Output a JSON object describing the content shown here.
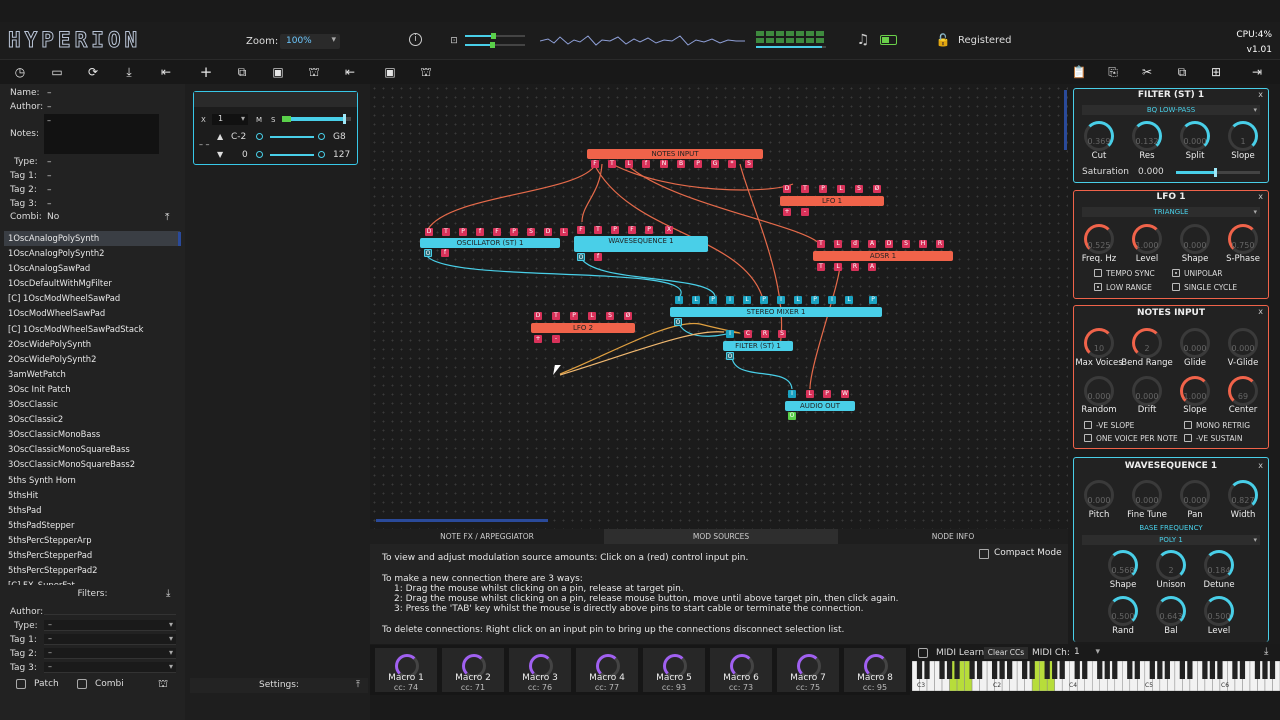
{
  "app": {
    "logo": "HYPERION",
    "zoom_label": "Zoom:",
    "zoom_value": "100%",
    "registered": "Registered",
    "cpu": "CPU:4%",
    "version": "v1.01"
  },
  "colors": {
    "accent_cyan": "#49cfe8",
    "node_red": "#f0634a",
    "pin_red": "#d9325a",
    "macro_purple": "#a060f0"
  },
  "toolbar": {
    "left_icons": [
      "history-icon",
      "folder-icon",
      "refresh-icon",
      "download-icon",
      "first-icon",
      "add-icon",
      "copy-icon",
      "save-icon",
      "patch-bay-icon",
      "first-icon"
    ],
    "mid_icons": [
      "save-icon",
      "patch-bay-icon"
    ],
    "right_icons": [
      "clipboard-icon",
      "paste-icon",
      "cut-icon",
      "duplicate-icon",
      "grid-icon",
      "exit-icon"
    ]
  },
  "meta": {
    "name_label": "Name:",
    "name": "–",
    "author_label": "Author:",
    "author": "–",
    "notes_label": "Notes:",
    "notes": "–",
    "type_label": "Type:",
    "type": "–",
    "tag1_label": "Tag 1:",
    "tag1": "–",
    "tag2_label": "Tag 2:",
    "tag2": "–",
    "tag3_label": "Tag 3:",
    "tag3": "–",
    "combi_label": "Combi:",
    "combi": "No"
  },
  "patches": [
    "1OscAnalogPolySynth",
    "1OscAnalogPolySynth2",
    "1OscAnalogSawPad",
    "1OscDefaultWithMgFilter",
    "[C] 1OscModWheelSawPad",
    "1OscModWheelSawPad",
    "[C] 1OscModWheelSawPadStack",
    "2OscWidePolySynth",
    "2OscWidePolySynth2",
    "3amWetPatch",
    "3Osc Init Patch",
    "3OscClassic",
    "3OscClassic2",
    "3OscClassicMonoBass",
    "3OscClassicMonoSquareBass",
    "3OscClassicMonoSquareBass2",
    "5ths Synth Horn",
    "5thsHit",
    "5thsPad",
    "5thsPadStepper",
    "5thsPercStepperArp",
    "5thsPercStepperPad",
    "5thsPercStepperPad2",
    "[C] FX_SuperFat"
  ],
  "filters": {
    "title": "Filters:",
    "author_label": "Author:",
    "type_label": "Type:",
    "type": "–",
    "tag1_label": "Tag 1:",
    "tag1": "–",
    "tag2_label": "Tag 2:",
    "tag2": "–",
    "tag3_label": "Tag 3:",
    "tag3": "–",
    "patch_label": "Patch",
    "combi_label": "Combi"
  },
  "kbzone": {
    "x": "X",
    "channel": "1",
    "m": "M",
    "s": "S",
    "low_note": "C-2",
    "high_note": "G8",
    "low_vel": "0",
    "high_vel": "127",
    "dash": "– –"
  },
  "settings_label": "Settings:",
  "nodes": {
    "notes_input": "NOTES INPUT",
    "lfo1": "LFO 1",
    "oscillator": "OSCILLATOR (ST) 1",
    "waveseq": "WAVESEQUENCE 1",
    "adsr": "ADSR 1",
    "stereo_mixer": "STEREO MIXER 1",
    "lfo2": "LFO 2",
    "filter": "FILTER (ST) 1",
    "audio_out": "AUDIO OUT"
  },
  "tabs": {
    "note_fx": "NOTE FX / ARPEGGIATOR",
    "mod_sources": "MOD SOURCES",
    "node_info": "NODE INFO",
    "compact": "Compact Mode"
  },
  "info": {
    "l1": "To view and adjust modulation source amounts: Click on a (red) control input pin.",
    "l2": "To make a new connection there are 3 ways:",
    "l3": "1: Drag the mouse whilst clicking on a pin, release at target pin.",
    "l4": "2: Drag the mouse whilst clicking on a pin, release mouse button, move until above target pin, then click again.",
    "l5": "3: Press the 'TAB' key whilst the mouse is directly above pins to start cable or terminate the connection.",
    "l6": "To delete connections: Right click on an input pin to bring up the connections disconnect selection list."
  },
  "macros": [
    {
      "name": "Macro 1",
      "cc": "cc:   74"
    },
    {
      "name": "Macro 2",
      "cc": "cc:   71"
    },
    {
      "name": "Macro 3",
      "cc": "cc:   76"
    },
    {
      "name": "Macro 4",
      "cc": "cc:   77"
    },
    {
      "name": "Macro 5",
      "cc": "cc:   93"
    },
    {
      "name": "Macro 6",
      "cc": "cc:   73"
    },
    {
      "name": "Macro 7",
      "cc": "cc:   75"
    },
    {
      "name": "Macro 8",
      "cc": "cc:   95"
    }
  ],
  "midi": {
    "learn": "MIDI Learn",
    "clear": "Clear CCs",
    "ch_label": "MIDI Ch:",
    "ch": "1",
    "oct1": "C2",
    "oct2": "C3",
    "oct3": "C4",
    "oct4": "C5",
    "oct5": "C6"
  },
  "filter_mod": {
    "title": "FILTER (ST) 1",
    "mode": "BQ LOW-PASS",
    "v_cut": "0.369",
    "v_res": "0.132",
    "v_split": "0.000",
    "v_slope": "1",
    "cut": "Cut",
    "res": "Res",
    "split": "Split",
    "slope": "Slope",
    "sat_label": "Saturation",
    "sat": "0.000"
  },
  "lfo_mod": {
    "title": "LFO 1",
    "wave": "TRIANGLE",
    "v1": "0.525",
    "v2": "1.000",
    "v3": "0.000",
    "v4": "0.750",
    "l1": "Freq. Hz",
    "l2": "Level",
    "l3": "Shape",
    "l4": "S-Phase",
    "o1": "TEMPO SYNC",
    "o2": "UNIPOLAR",
    "o3": "LOW RANGE",
    "o4": "SINGLE CYCLE"
  },
  "notes_mod": {
    "title": "NOTES INPUT",
    "v1": "10",
    "v2": "2",
    "v3": "0.000",
    "v4": "0.000",
    "l1": "Max Voices",
    "l2": "Bend Range",
    "l3": "Glide",
    "l4": "V-Glide",
    "v5": "0.000",
    "v6": "0.000",
    "v7": "1.000",
    "v8": "69",
    "l5": "Random",
    "l6": "Drift",
    "l7": "Slope",
    "l8": "Center",
    "o1": "-VE SLOPE",
    "o2": "MONO RETRIG",
    "o3": "ONE VOICE PER NOTE",
    "o4": "-VE SUSTAIN"
  },
  "wave_mod": {
    "title": "WAVESEQUENCE 1",
    "v1": "0.000",
    "v2": "0.000",
    "v3": "0.000",
    "v4": "0.827",
    "l1": "Pitch",
    "l2": "Fine Tune",
    "l3": "Pan",
    "l4": "Width",
    "base": "BASE FREQUENCY",
    "poly": "POLY 1",
    "v5": "0.568",
    "v6": "2",
    "v7": "0.184",
    "l5": "Shape",
    "l6": "Unison",
    "l7": "Detune",
    "v8": "0.500",
    "v9": "0.643",
    "v10": "0.500",
    "l8": "Rand",
    "l9": "Bal",
    "l10": "Level"
  }
}
